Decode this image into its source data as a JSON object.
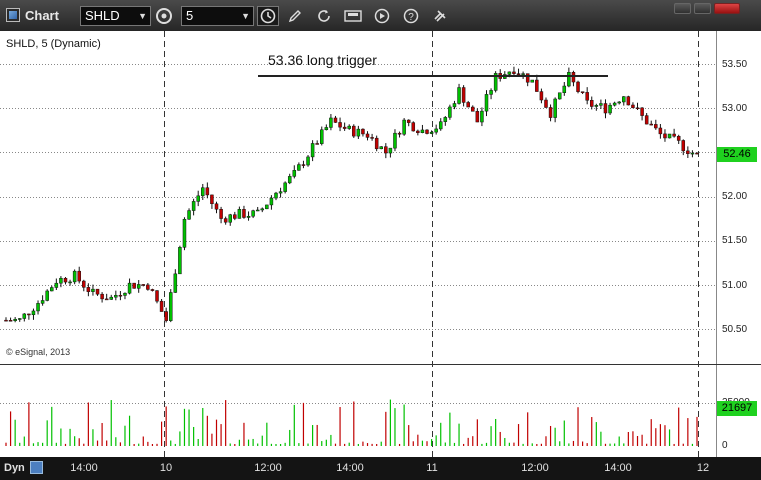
{
  "window": {
    "title": "Chart"
  },
  "toolbar": {
    "symbol": "SHLD",
    "interval": "5",
    "icons": [
      "settings-icon",
      "time-template-icon",
      "pencil-icon",
      "refresh-icon",
      "save-icon",
      "play-icon",
      "help-icon",
      "link-icon"
    ]
  },
  "chart": {
    "header": "SHLD, 5 (Dynamic)",
    "copyright": "© eSignal, 2013",
    "annotation": "53.36 long trigger",
    "last_price": "52.46",
    "last_volume": "21697",
    "dyn_label": "Dyn",
    "price_ticks": [
      "53.50",
      "53.00",
      "52.50",
      "52.00",
      "51.50",
      "51.00",
      "50.50"
    ],
    "volume_ticks": [
      "25000",
      "0"
    ],
    "time_labels": [
      "14:00",
      "10",
      "12:00",
      "14:00",
      "11",
      "12:00",
      "14:00",
      "12"
    ],
    "colors": {
      "up": "#00c000",
      "down": "#c00000",
      "flag": "#1fd11f"
    }
  },
  "chart_data": {
    "type": "candlestick",
    "symbol": "SHLD",
    "interval": "5 min",
    "ylim": [
      50.3,
      53.7
    ],
    "trigger_line": 53.36,
    "approx_closes": [
      50.6,
      50.8,
      51.05,
      51.1,
      50.9,
      50.85,
      51.0,
      51.0,
      50.6,
      51.75,
      52.1,
      51.75,
      51.8,
      51.8,
      52.05,
      52.25,
      52.55,
      52.85,
      52.75,
      52.7,
      52.5,
      52.85,
      52.75,
      52.8,
      53.2,
      52.85,
      53.35,
      53.45,
      53.3,
      52.95,
      53.35,
      53.05,
      53.0,
      53.15,
      52.9,
      52.7,
      52.6,
      52.46
    ]
  }
}
